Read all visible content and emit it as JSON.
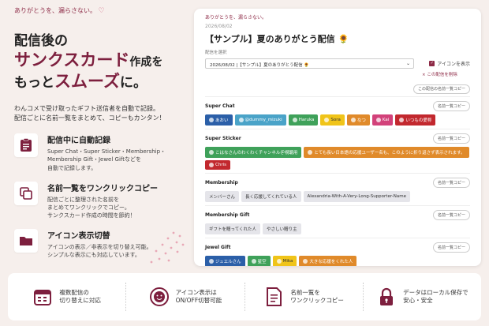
{
  "tagline": "ありがとうを、漏らさない。",
  "headline": {
    "line1": "配信後の",
    "line2": "サンクスカード",
    "line2b": "作成を",
    "line3a": "もっと",
    "line3b": "スムーズ",
    "line3c": "に。"
  },
  "description": "わんコメで受け取ったギフト送信者を自動で記録。\n配信ごとに名前一覧をまとめて、コピーもカンタン！",
  "features": [
    {
      "title": "配信中に自動記録",
      "text": "Super Chat・Super Sticker・Membership・\nMembership Gift・Jewel Giftなどを\n自動で記録します。",
      "icon": "clipboard-icon"
    },
    {
      "title": "名前一覧をワンクリックコピー",
      "text": "配信ごとに整理された名前を\nまとめてワンクリックでコピー。\nサンクスカード作成の時間を節約！",
      "icon": "copy-icon"
    },
    {
      "title": "アイコン表示切替",
      "text": "アイコンの表示／非表示を切り替え可能。\nシンプルな表示にも対応しています。",
      "icon": "folder-icon"
    }
  ],
  "app": {
    "tag": "ありがとうを、漏らさない。",
    "date": "2026/08/02",
    "title": "【サンプル】夏のありがとう配信 🌻",
    "select_label": "配信を選択",
    "select_value": "2026/08/02 |【サンプル】夏のありがとう配信 🌻",
    "show_icon_label": "アイコンを表示",
    "clear_label": "× この配信を削除",
    "copy_all_label": "この配信の名前一覧コピー",
    "copy_label": "名前一覧コピー",
    "sections": [
      {
        "name": "Super Chat",
        "chips": [
          {
            "t": "あおい",
            "c": "#2b5fa8"
          },
          {
            "t": "@dummy_mizuki",
            "c": "#4aa3c8"
          },
          {
            "t": "Haruka",
            "c": "#3fa15a"
          },
          {
            "t": "Sora",
            "c": "#f0c419",
            "dark": true
          },
          {
            "t": "なつ",
            "c": "#e08a2a"
          },
          {
            "t": "Kai",
            "c": "#d2427a"
          },
          {
            "t": "いつもの愛称",
            "c": "#c2282e"
          }
        ]
      },
      {
        "name": "Super Sticker",
        "chips": [
          {
            "t": "こはなさんのわくわくチャンネル＠視聴用",
            "c": "#3fa15a"
          },
          {
            "t": "とても長い日本語の応援ユーザー名も、このように折り返さず表示されます。",
            "c": "#e08a2a"
          },
          {
            "t": "Chris",
            "c": "#c2282e"
          }
        ]
      },
      {
        "name": "Membership",
        "chips": [
          {
            "t": "メンバーさん",
            "g": true
          },
          {
            "t": "長く応援してくれている人",
            "g": true
          },
          {
            "t": "Alexandria-With-A-Very-Long-Supporter-Name",
            "g": true
          }
        ]
      },
      {
        "name": "Membership Gift",
        "chips": [
          {
            "t": "ギフトを贈ってくれた人",
            "g": true
          },
          {
            "t": "やさしい贈り主",
            "g": true
          }
        ]
      },
      {
        "name": "Jewel Gift",
        "chips": [
          {
            "t": "ジュエルさん",
            "c": "#2b5fa8"
          },
          {
            "t": "星空",
            "c": "#3fa15a"
          },
          {
            "t": "Mika",
            "c": "#f0c419",
            "dark": true
          },
          {
            "t": "大きな応援をくれた人",
            "c": "#e08a2a"
          }
        ]
      }
    ]
  },
  "bottom": [
    {
      "text": "複数配信の\n切り替えに対応",
      "icon": "calendar-icon"
    },
    {
      "text": "アイコン表示は\nON/OFF切替可能",
      "icon": "smile-toggle-icon"
    },
    {
      "text": "名前一覧を\nワンクリックコピー",
      "icon": "document-icon"
    },
    {
      "text": "データはローカル保存で\n安心・安全",
      "icon": "lock-icon"
    }
  ],
  "colors": {
    "accent": "#8d2a46",
    "bg": "#f6efec"
  }
}
